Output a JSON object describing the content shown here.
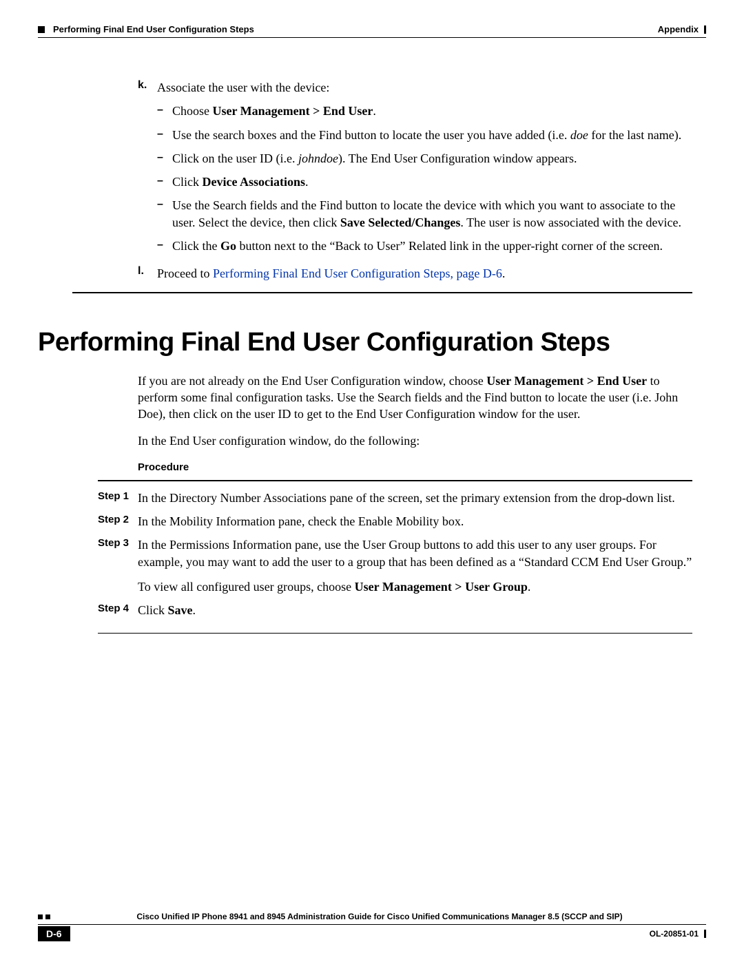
{
  "header": {
    "left": "Performing Final End User Configuration Steps",
    "right": "Appendix"
  },
  "list_k": {
    "marker": "k.",
    "intro": "Associate the user with the device:",
    "dashes": [
      {
        "pre": "Choose ",
        "bold": "User Management > End User",
        "post": "."
      },
      {
        "text_parts": [
          "Use the search boxes and the Find button to locate the user you have added (i.e. ",
          {
            "i": "doe"
          },
          " for the last name)."
        ]
      },
      {
        "text_parts": [
          "Click on the user ID (i.e. ",
          {
            "i": "johndoe"
          },
          "). The End User Configuration window appears."
        ]
      },
      {
        "pre": "Click ",
        "bold": "Device Associations",
        "post": "."
      },
      {
        "text_parts": [
          "Use the Search fields and the Find button to locate the device with which you want to associate to the user. Select the device, then click ",
          {
            "b": "Save Selected/Changes"
          },
          ". The user is now associated with the device."
        ]
      },
      {
        "text_parts": [
          "Click the ",
          {
            "b": "Go"
          },
          " button next to the “Back to User” Related link in the upper-right corner of the screen."
        ]
      }
    ]
  },
  "list_l": {
    "marker": "l.",
    "pre": "Proceed to ",
    "link": "Performing Final End User Configuration Steps, page D-6",
    "post": "."
  },
  "section": {
    "heading": "Performing Final End User Configuration Steps",
    "para1_parts": [
      "If you are not already on the End User Configuration window, choose ",
      {
        "b": "User Management > End User"
      },
      " to perform some final configuration tasks. Use the Search fields and the Find button to locate the user (i.e. John Doe), then click on the user ID to get to the End User Configuration window for the user."
    ],
    "para2": "In the End User configuration window, do the following:",
    "procedure_label": "Procedure"
  },
  "steps": [
    {
      "label": "Step 1",
      "body_parts": [
        "In the Directory Number Associations pane of the screen, set the primary extension from the drop-down list."
      ]
    },
    {
      "label": "Step 2",
      "body_parts": [
        "In the Mobility Information pane, check the Enable Mobility box."
      ]
    },
    {
      "label": "Step 3",
      "body_parts": [
        "In the Permissions Information pane, use the User Group buttons to add this user to any user groups. For example, you may want to add the user to a group that has been defined as a “Standard CCM End User Group.”"
      ],
      "extra_parts": [
        "To view all configured user groups, choose ",
        {
          "b": "User Management > User Group"
        },
        "."
      ]
    },
    {
      "label": "Step 4",
      "body_parts": [
        "Click ",
        {
          "b": "Save"
        },
        "."
      ]
    }
  ],
  "footer": {
    "title": "Cisco Unified IP Phone 8941 and 8945 Administration Guide for Cisco Unified Communications Manager 8.5 (SCCP and SIP)",
    "page": "D-6",
    "code": "OL-20851-01"
  }
}
